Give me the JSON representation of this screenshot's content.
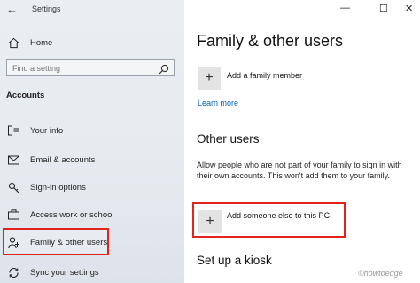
{
  "window": {
    "title": "Settings",
    "back_icon": "arrow-left-icon",
    "controls": [
      "—",
      "☐",
      "✕"
    ]
  },
  "sidebar": {
    "home_label": "Home",
    "search_placeholder": "Find a setting",
    "section_label": "Accounts",
    "items": [
      {
        "label": "Your info",
        "icon": "contact-card-icon"
      },
      {
        "label": "Email & accounts",
        "icon": "envelope-icon"
      },
      {
        "label": "Sign-in options",
        "icon": "key-icon"
      },
      {
        "label": "Access work or school",
        "icon": "briefcase-icon"
      },
      {
        "label": "Family & other users",
        "icon": "person-add-icon",
        "selected": true
      },
      {
        "label": "Sync your settings",
        "icon": "sync-icon"
      }
    ]
  },
  "main": {
    "page_title": "Family & other users",
    "add_family_label": "Add a family member",
    "learn_more": "Learn more",
    "other_users_heading": "Other users",
    "other_users_desc": "Allow people who are not part of your family to sign in with their own accounts. This won't add them to your family.",
    "add_someone_label": "Add someone else to this PC",
    "kiosk_heading": "Set up a kiosk"
  },
  "watermark": "©howtoedge",
  "colors": {
    "accent_link": "#0063b1",
    "highlight_border": "#e0241d"
  }
}
